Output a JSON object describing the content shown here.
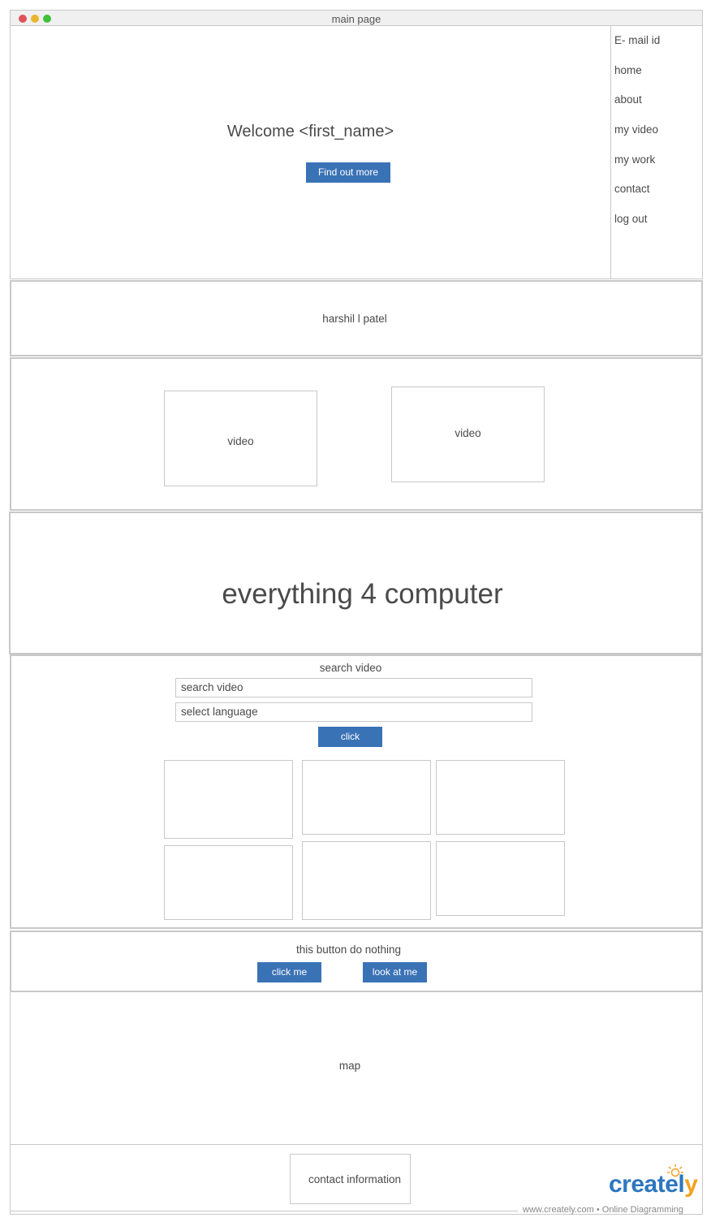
{
  "window": {
    "title": "main page"
  },
  "hero": {
    "welcome": "Welcome <first_name>",
    "cta_label": "Find out more"
  },
  "sidebar": {
    "items": [
      {
        "label": "E- mail id"
      },
      {
        "label": "home"
      },
      {
        "label": "about"
      },
      {
        "label": "my video"
      },
      {
        "label": "my work"
      },
      {
        "label": "contact"
      },
      {
        "label": "log out"
      }
    ]
  },
  "name_section": {
    "name": "harshil l patel"
  },
  "videos": {
    "left_label": "video",
    "right_label": "video"
  },
  "banner": {
    "headline": "everything 4 computer"
  },
  "search": {
    "title": "search video",
    "search_placeholder": "search video",
    "language_placeholder": "select language",
    "submit_label": "click"
  },
  "buttons_section": {
    "caption": "this button do nothing",
    "click_me_label": "click me",
    "look_at_me_label": "look at me"
  },
  "map": {
    "label": "map"
  },
  "contact": {
    "label": "contact information"
  },
  "branding": {
    "logo_main": "createl",
    "logo_accent": "y",
    "watermark": "www.creately.com • Online Diagramming"
  },
  "colors": {
    "accent": "#3a72b6",
    "border": "#c8c8c8",
    "dot_red": "#e0525a",
    "dot_yellow": "#e9b531",
    "dot_green": "#3fbf3a"
  }
}
